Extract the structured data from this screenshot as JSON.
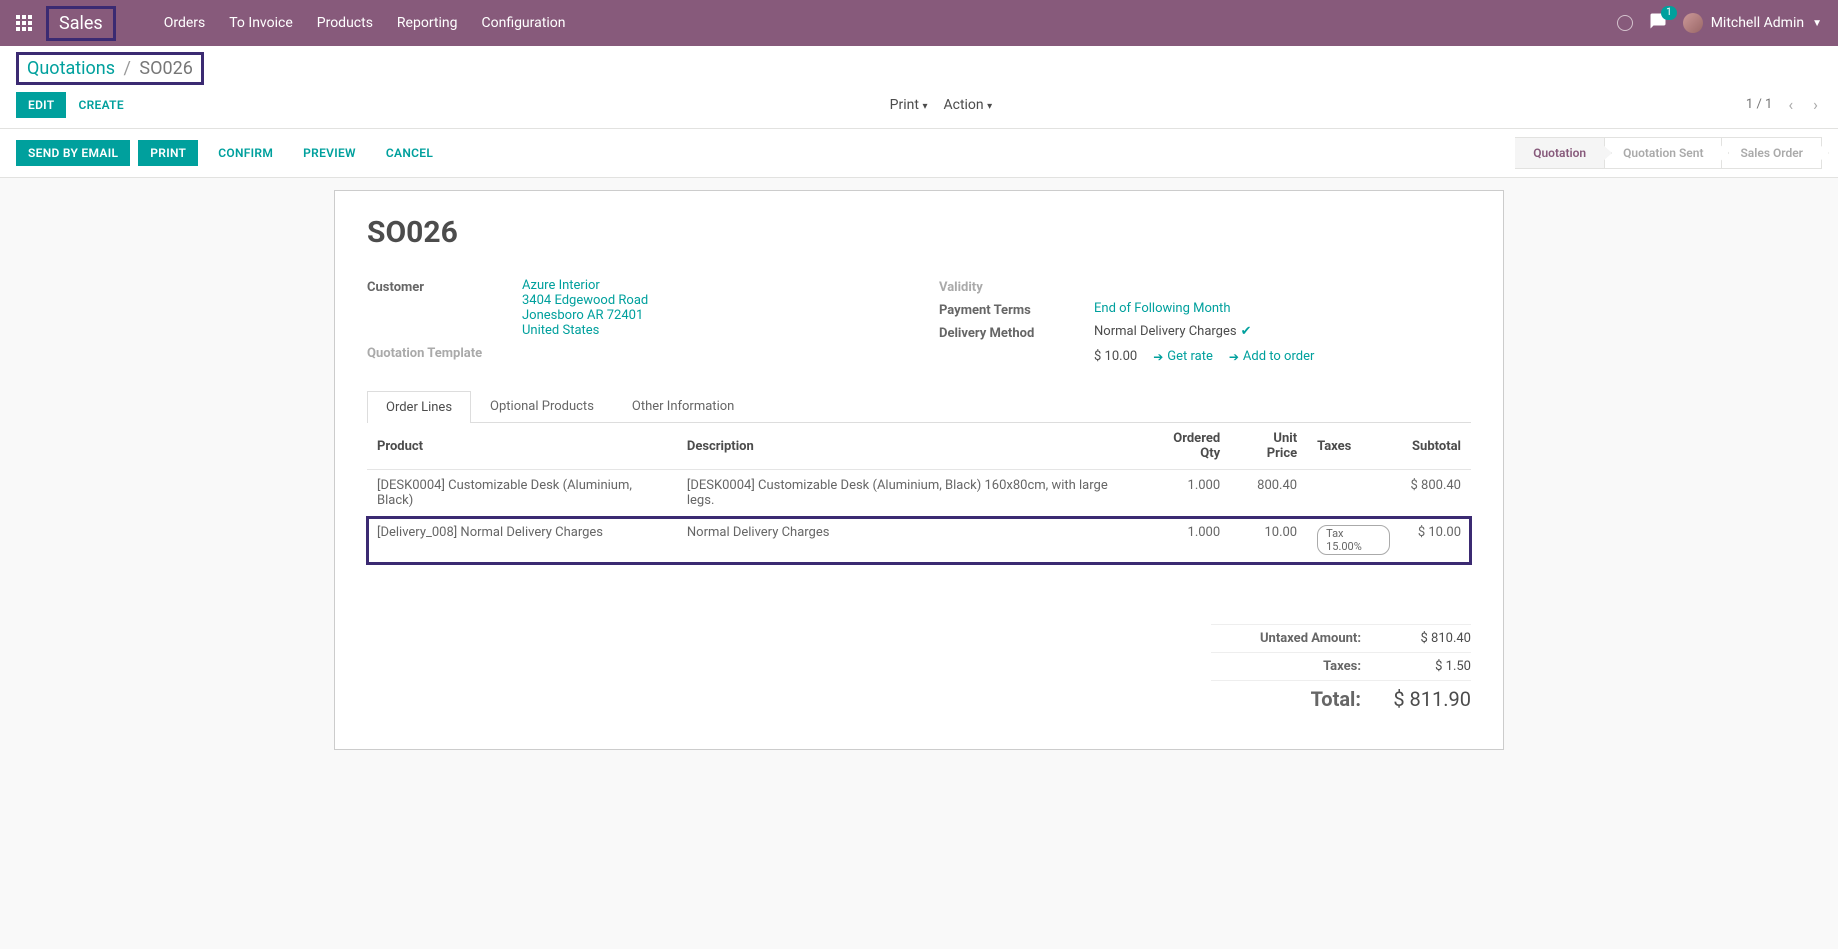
{
  "app_name": "Sales",
  "nav_menu": [
    "Orders",
    "To Invoice",
    "Products",
    "Reporting",
    "Configuration"
  ],
  "chat_badge": "1",
  "user_name": "Mitchell Admin",
  "breadcrumb": {
    "parent": "Quotations",
    "current": "SO026"
  },
  "buttons": {
    "edit": "Edit",
    "create": "Create",
    "print_menu": "Print",
    "action_menu": "Action"
  },
  "pager": {
    "text": "1 / 1"
  },
  "statusbar_buttons": {
    "send_email": "Send by Email",
    "print": "Print",
    "confirm": "Confirm",
    "preview": "Preview",
    "cancel": "Cancel"
  },
  "stages": {
    "quotation": "Quotation",
    "quotation_sent": "Quotation Sent",
    "sales_order": "Sales Order"
  },
  "record": {
    "name": "SO026",
    "labels": {
      "customer": "Customer",
      "quotation_template": "Quotation Template",
      "validity": "Validity",
      "payment_terms": "Payment Terms",
      "delivery_method": "Delivery Method"
    },
    "customer": {
      "name": "Azure Interior",
      "street": "3404 Edgewood Road",
      "city": "Jonesboro AR 72401",
      "country": "United States"
    },
    "payment_terms": "End of Following Month",
    "delivery_method": "Normal Delivery Charges",
    "delivery_price": "$ 10.00",
    "get_rate": "Get rate",
    "add_to_order": "Add to order"
  },
  "tabs": {
    "order_lines": "Order Lines",
    "optional_products": "Optional Products",
    "other_info": "Other Information"
  },
  "table": {
    "headers": {
      "product": "Product",
      "description": "Description",
      "ordered_qty": "Ordered Qty",
      "unit_price": "Unit Price",
      "taxes": "Taxes",
      "subtotal": "Subtotal"
    },
    "rows": [
      {
        "product": "[DESK0004] Customizable Desk (Aluminium, Black)",
        "description": "[DESK0004] Customizable Desk (Aluminium, Black) 160x80cm, with large legs.",
        "qty": "1.000",
        "unit_price": "800.40",
        "taxes": "",
        "subtotal": "$ 800.40",
        "highlighted": false
      },
      {
        "product": "[Delivery_008] Normal Delivery Charges",
        "description": "Normal Delivery Charges",
        "qty": "1.000",
        "unit_price": "10.00",
        "taxes": "Tax 15.00%",
        "subtotal": "$ 10.00",
        "highlighted": true
      }
    ]
  },
  "totals": {
    "untaxed_label": "Untaxed Amount:",
    "untaxed": "$ 810.40",
    "taxes_label": "Taxes:",
    "taxes": "$ 1.50",
    "total_label": "Total:",
    "total": "$ 811.90"
  }
}
